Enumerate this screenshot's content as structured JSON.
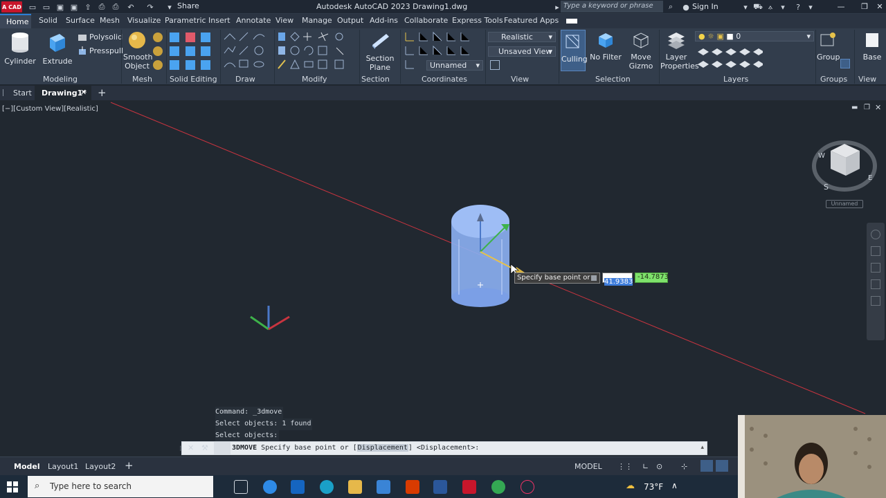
{
  "titlebar": {
    "logo": "A CAD",
    "share": "Share",
    "title": "Autodesk AutoCAD 2023    Drawing1.dwg",
    "search_placeholder": "Type a keyword or phrase",
    "sign_in": "Sign In"
  },
  "ribbon_tabs": [
    "Home",
    "Solid",
    "Surface",
    "Mesh",
    "Visualize",
    "Parametric",
    "Insert",
    "Annotate",
    "View",
    "Manage",
    "Output",
    "Add-ins",
    "Collaborate",
    "Express Tools",
    "Featured Apps"
  ],
  "ribbon": {
    "modeling": {
      "cylinder": "Cylinder",
      "extrude": "Extrude",
      "polysolid": "Polysolid",
      "presspull": "Presspull",
      "label": "Modeling"
    },
    "mesh": {
      "smooth_object": "Smooth Object",
      "label": "Mesh"
    },
    "solid_editing": {
      "label": "Solid Editing"
    },
    "draw": {
      "label": "Draw"
    },
    "modify": {
      "label": "Modify"
    },
    "section": {
      "section_plane": "Section Plane",
      "label": "Section"
    },
    "coordinates": {
      "label": "Coordinates",
      "ucs_value": "Unnamed"
    },
    "view": {
      "visual_style": "Realistic",
      "named_view": "Unsaved View",
      "label": "View"
    },
    "selection": {
      "culling": "Culling",
      "no_filter": "No Filter",
      "move_gizmo": "Move Gizmo",
      "label": "Selection"
    },
    "layers": {
      "layer_properties": "Layer Properties",
      "current_layer": "0",
      "label": "Layers"
    },
    "groups": {
      "group": "Group",
      "label": "Groups"
    },
    "view2": {
      "base": "Base",
      "label": "View"
    }
  },
  "doc_tabs": {
    "start": "Start",
    "drawing": "Drawing1*"
  },
  "viewport": {
    "label": "[−][Custom View][Realistic]",
    "viewcube_label": "Unnamed",
    "tooltip": "Specify base point or",
    "input_x": "41.9383",
    "input_y": "-14.7873"
  },
  "command": {
    "history": [
      "Command: _3dmove",
      "Select objects: 1 found",
      "Select objects:"
    ],
    "prompt_cmd": "3DMOVE",
    "prompt_text": "Specify base point or [",
    "prompt_option": "Displacement",
    "prompt_tail": "] <Displacement>:"
  },
  "layout_tabs": {
    "model": "Model",
    "layout1": "Layout1",
    "layout2": "Layout2"
  },
  "status": {
    "mode": "MODEL"
  },
  "taskbar": {
    "search_placeholder": "Type here to search",
    "weather": "73°F"
  },
  "colors": {
    "accent": "#2c7fd6",
    "ribbon_bg": "#323d4c",
    "viewport_bg": "#212830",
    "cylinder": "#8aaef0"
  }
}
